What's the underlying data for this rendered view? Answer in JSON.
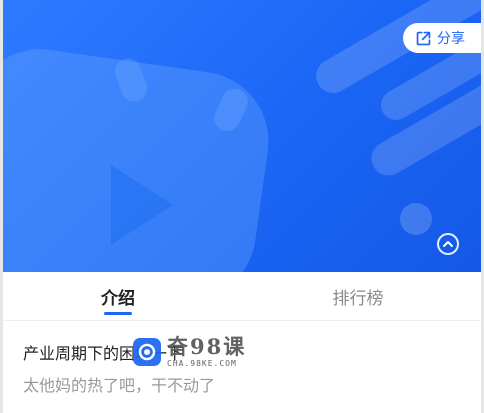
{
  "header": {
    "share_label": "分享"
  },
  "tabs": [
    {
      "label": "介绍",
      "active": true
    },
    {
      "label": "排行榜",
      "active": false
    }
  ],
  "content": {
    "title": "产业周期下的困境一下",
    "subtitle": "太他妈的热了吧，干不动了"
  },
  "watermark": {
    "main": "奋98课",
    "sub": "CHA.98KE.COM"
  },
  "colors": {
    "accent": "#1b66f5",
    "banner": "#2f7bff",
    "subtitle": "#9a9a9a"
  },
  "icons": {
    "share": "share-icon",
    "collapse": "chevron-up-circle-icon",
    "banner": "tv-play-icon"
  }
}
